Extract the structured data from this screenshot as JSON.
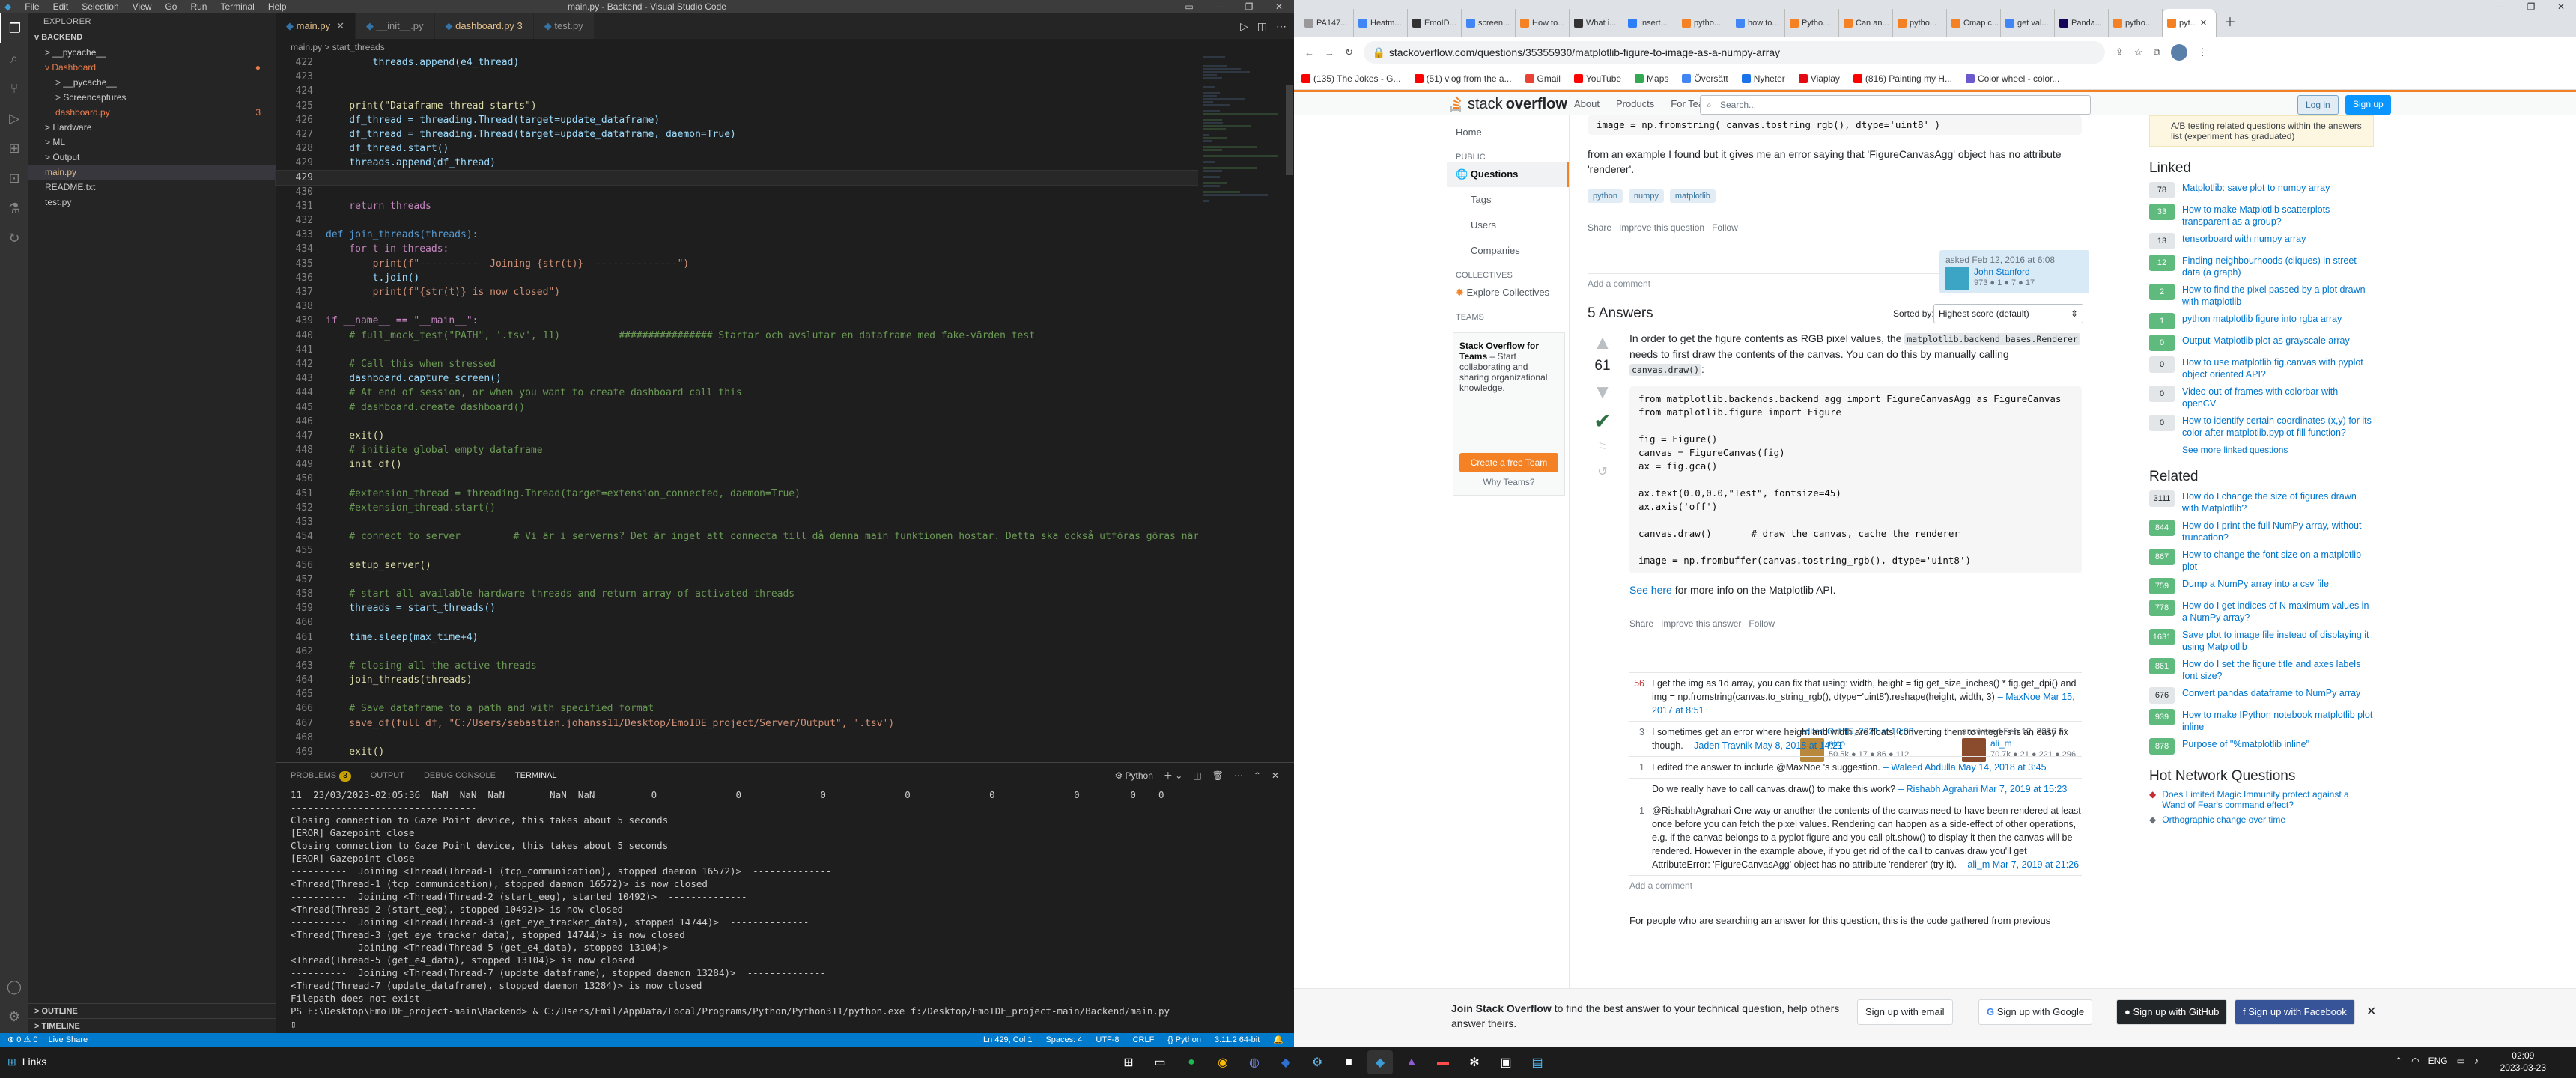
{
  "vscode": {
    "title": "main.py - Backend - Visual Studio Code",
    "menu": [
      "File",
      "Edit",
      "Selection",
      "View",
      "Go",
      "Run",
      "Terminal",
      "Help"
    ],
    "explorer_header": "EXPLORER",
    "root": "BACKEND",
    "tree": [
      {
        "label": "> __pycache__",
        "indent": 1,
        "color": "#cccccc"
      },
      {
        "label": "v Dashboard",
        "indent": 1,
        "color": "#e97c4c",
        "dot": "●"
      },
      {
        "label": "> __pycache__",
        "indent": 2,
        "color": "#cccccc"
      },
      {
        "label": "> Screencaptures",
        "indent": 2,
        "color": "#cccccc"
      },
      {
        "label": "dashboard.py",
        "indent": 2,
        "color": "#e97c4c",
        "dot": "3"
      },
      {
        "label": "> Hardware",
        "indent": 1,
        "color": "#cccccc"
      },
      {
        "label": "> ML",
        "indent": 1,
        "color": "#cccccc"
      },
      {
        "label": "> Output",
        "indent": 1,
        "color": "#cccccc"
      },
      {
        "label": "main.py",
        "indent": 1,
        "color": "#e2c08d"
      },
      {
        "label": "README.txt",
        "indent": 1,
        "color": "#cccccc"
      },
      {
        "label": "test.py",
        "indent": 1,
        "color": "#cccccc"
      }
    ],
    "outline": "> OUTLINE",
    "timeline": "> TIMELINE",
    "tabs": [
      {
        "label": "main.py",
        "active": true,
        "color": "#e2c08d"
      },
      {
        "label": "__init__.py",
        "active": false,
        "color": "#969696"
      },
      {
        "label": "dashboard.py 3",
        "active": false,
        "color": "#e2c08d"
      },
      {
        "label": "test.py",
        "active": false,
        "color": "#969696"
      }
    ],
    "breadcrumb": "main.py > start_threads",
    "code": [
      {
        "n": "422",
        "t": "        threads.append(e4_thread)",
        "k": "vr"
      },
      {
        "n": "423",
        "t": ""
      },
      {
        "n": "424",
        "t": ""
      },
      {
        "n": "425",
        "t": "    print(\"Dataframe thread starts\")",
        "k": "fn"
      },
      {
        "n": "426",
        "t": "    df_thread = threading.Thread(target=update_dataframe)",
        "k": "vr"
      },
      {
        "n": "427",
        "t": "    df_thread = threading.Thread(target=update_dataframe, daemon=True)",
        "k": "vr"
      },
      {
        "n": "428",
        "t": "    df_thread.start()",
        "k": "vr"
      },
      {
        "n": "429",
        "t": "    threads.append(df_thread)",
        "k": "vr"
      },
      {
        "n": "429",
        "t": "",
        "cur": true
      },
      {
        "n": "430",
        "t": ""
      },
      {
        "n": "431",
        "t": "    return threads",
        "k": "kw"
      },
      {
        "n": "432",
        "t": ""
      },
      {
        "n": "433",
        "t": "def join_threads(threads):",
        "k": "bl"
      },
      {
        "n": "434",
        "t": "    for t in threads:",
        "k": "kw"
      },
      {
        "n": "435",
        "t": "        print(f\"----------  Joining {str(t)}  --------------\")",
        "k": "st"
      },
      {
        "n": "436",
        "t": "        t.join()",
        "k": "vr"
      },
      {
        "n": "437",
        "t": "        print(f\"{str(t)} is now closed\")",
        "k": "st"
      },
      {
        "n": "438",
        "t": ""
      },
      {
        "n": "439",
        "t": "if __name__ == \"__main__\":",
        "k": "kw"
      },
      {
        "n": "440",
        "t": "    # full_mock_test(\"PATH\", '.tsv', 11)          ################ Startar och avslutar en dataframe med fake-värden test",
        "k": "cm"
      },
      {
        "n": "441",
        "t": ""
      },
      {
        "n": "442",
        "t": "    # Call this when stressed",
        "k": "cm"
      },
      {
        "n": "443",
        "t": "    dashboard.capture_screen()",
        "k": "vr"
      },
      {
        "n": "444",
        "t": "    # At end of session, or when you want to create dashboard call this",
        "k": "cm"
      },
      {
        "n": "445",
        "t": "    # dashboard.create_dashboard()",
        "k": "cm"
      },
      {
        "n": "446",
        "t": ""
      },
      {
        "n": "447",
        "t": "    exit()",
        "k": "fn"
      },
      {
        "n": "448",
        "t": "    # initiate global empty dataframe",
        "k": "cm"
      },
      {
        "n": "449",
        "t": "    init_df()",
        "k": "fn"
      },
      {
        "n": "450",
        "t": ""
      },
      {
        "n": "451",
        "t": "    #extension_thread = threading.Thread(target=extension_connected, daemon=True)",
        "k": "cm"
      },
      {
        "n": "452",
        "t": "    #extension_thread.start()",
        "k": "cm"
      },
      {
        "n": "453",
        "t": ""
      },
      {
        "n": "454",
        "t": "    # connect to server         # Vi är i serverns? Det är inget att connecta till då denna main funktionen hostar. Detta ska också utföras göras när p",
        "k": "cm"
      },
      {
        "n": "455",
        "t": ""
      },
      {
        "n": "456",
        "t": "    setup_server()",
        "k": "fn"
      },
      {
        "n": "457",
        "t": ""
      },
      {
        "n": "458",
        "t": "    # start all available hardware threads and return array of activated threads",
        "k": "cm"
      },
      {
        "n": "459",
        "t": "    threads = start_threads()",
        "k": "vr"
      },
      {
        "n": "460",
        "t": ""
      },
      {
        "n": "461",
        "t": "    time.sleep(max_time+4)",
        "k": "vr"
      },
      {
        "n": "462",
        "t": ""
      },
      {
        "n": "463",
        "t": "    # closing all the active threads",
        "k": "cm"
      },
      {
        "n": "464",
        "t": "    join_threads(threads)",
        "k": "fn"
      },
      {
        "n": "465",
        "t": ""
      },
      {
        "n": "466",
        "t": "    # Save dataframe to a path and with specified format",
        "k": "cm"
      },
      {
        "n": "467",
        "t": "    save_df(full_df, \"C:/Users/sebastian.johanss11/Desktop/EmoIDE_project/Server/Output\", '.tsv')",
        "k": "st"
      },
      {
        "n": "468",
        "t": ""
      },
      {
        "n": "469",
        "t": "    exit()",
        "k": "fn"
      }
    ],
    "panel_tabs": [
      "PROBLEMS",
      "OUTPUT",
      "DEBUG CONSOLE",
      "TERMINAL"
    ],
    "problems_count": "3",
    "terminal_shell": "Python",
    "terminal": [
      "11  23/03/2023-02:05:36  NaN  NaN  NaN        NaN  NaN          0              0              0              0              0              0         0    0",
      "---------------------------------",
      "Closing connection to Gaze Point device, this takes about 5 seconds",
      "[EROR] Gazepoint close",
      "Closing connection to Gaze Point device, this takes about 5 seconds",
      "[EROR] Gazepoint close",
      "----------  Joining <Thread(Thread-1 (tcp_communication), stopped daemon 16572)>  --------------",
      "<Thread(Thread-1 (tcp_communication), stopped daemon 16572)> is now closed",
      "----------  Joining <Thread(Thread-2 (start_eeg), started 10492)>  --------------",
      "<Thread(Thread-2 (start_eeg), stopped 10492)> is now closed",
      "----------  Joining <Thread(Thread-3 (get_eye_tracker_data), stopped 14744)>  --------------",
      "<Thread(Thread-3 (get_eye_tracker_data), stopped 14744)> is now closed",
      "----------  Joining <Thread(Thread-5 (get_e4_data), stopped 13104)>  --------------",
      "<Thread(Thread-5 (get_e4_data), stopped 13104)> is now closed",
      "----------  Joining <Thread(Thread-7 (update_dataframe), stopped daemon 13284)>  --------------",
      "<Thread(Thread-7 (update_dataframe), stopped daemon 13284)> is now closed",
      "Filepath does not exist",
      "PS F:\\Desktop\\EmoIDE_project-main\\Backend> & C:/Users/Emil/AppData/Local/Programs/Python/Python311/python.exe f:/Desktop/EmoIDE_project-main/Backend/main.py",
      "▯"
    ],
    "status_left": [
      "⊗ 0  ⚠ 0",
      "Live Share"
    ],
    "status_right": [
      "Ln 429, Col 1",
      "Spaces: 4",
      "UTF-8",
      "CRLF",
      "{} Python",
      "3.11.2 64-bit"
    ]
  },
  "browser": {
    "tabs": [
      {
        "label": "PA147...",
        "color": "#999"
      },
      {
        "label": "Heatm...",
        "color": "#4285f4"
      },
      {
        "label": "EmoID...",
        "color": "#333"
      },
      {
        "label": "screen...",
        "color": "#4285f4"
      },
      {
        "label": "How to...",
        "color": "#f48225"
      },
      {
        "label": "What i...",
        "color": "#333"
      },
      {
        "label": "Insert...",
        "color": "#2d7ff9"
      },
      {
        "label": "pytho...",
        "color": "#f48225"
      },
      {
        "label": "how to...",
        "color": "#4285f4"
      },
      {
        "label": "Pytho...",
        "color": "#f48225"
      },
      {
        "label": "Can an...",
        "color": "#f48225"
      },
      {
        "label": "pytho...",
        "color": "#f48225"
      },
      {
        "label": "Cmap c...",
        "color": "#f48225"
      },
      {
        "label": "get val...",
        "color": "#4285f4"
      },
      {
        "label": "Panda...",
        "color": "#150458"
      },
      {
        "label": "pytho...",
        "color": "#f48225"
      },
      {
        "label": "pyt...",
        "color": "#f48225",
        "active": true
      }
    ],
    "url": "stackoverflow.com/questions/35355930/matplotlib-figure-to-image-as-a-numpy-array",
    "bookmarks": [
      "(135) The Jokes - G...",
      "(51) vlog from the a...",
      "Gmail",
      "YouTube",
      "Maps",
      "Översätt",
      "Nyheter",
      "Viaplay",
      "(816) Painting my H...",
      "Color wheel - color..."
    ],
    "bookmark_colors": [
      "#ff0000",
      "#ff0000",
      "#ea4335",
      "#ff0000",
      "#34a853",
      "#4285f4",
      "#1a73e8",
      "#e50914",
      "#ff0000",
      "#6a5acd"
    ]
  },
  "so": {
    "logo_a": "stack",
    "logo_b": "overflow",
    "nav": [
      "About",
      "Products",
      "For Teams"
    ],
    "search_placeholder": "Search...",
    "login": "Log in",
    "signup": "Sign up",
    "left": {
      "home": "Home",
      "public": "PUBLIC",
      "questions": "Questions",
      "tags": "Tags",
      "users": "Users",
      "companies": "Companies",
      "collectives": "COLLECTIVES",
      "explore": "Explore Collectives",
      "teams": "TEAMS",
      "teams_title": "Stack Overflow for Teams",
      "teams_text": "– Start collaborating and sharing organizational knowledge.",
      "teams_btn": "Create a free Team",
      "why": "Why Teams?"
    },
    "q_code_top": "image = np.fromstring( canvas.tostring_rgb(), dtype='uint8' )",
    "q_text": "from an example I found but it gives me an error saying that 'FigureCanvasAgg' object has no attribute 'renderer'.",
    "tags": [
      "python",
      "numpy",
      "matplotlib"
    ],
    "post_menu": [
      "Share",
      "Improve this question",
      "Follow"
    ],
    "asked": "asked Feb 12, 2016 at 6:08",
    "asker": "John Stanford",
    "asker_rep": "973 ● 1 ● 7 ● 17",
    "add_comment": "Add a comment",
    "answers_count": "5 Answers",
    "sorted_by": "Sorted by:",
    "sort_value": "Highest score (default)",
    "vote": "61",
    "a_text1": "In order to get the figure contents as RGB pixel values, the",
    "a_code_inline": "matplotlib.backend_bases.Renderer",
    "a_text2": "needs to first draw the contents of the canvas. You can do this by manually calling",
    "a_code_inline2": "canvas.draw()",
    "a_code": "from matplotlib.backends.backend_agg import FigureCanvasAgg as FigureCanvas\nfrom matplotlib.figure import Figure\n\nfig = Figure()\ncanvas = FigureCanvas(fig)\nax = fig.gca()\n\nax.text(0.0,0.0,\"Test\", fontsize=45)\nax.axis('off')\n\ncanvas.draw()       # draw the canvas, cache the renderer\n\nimage = np.frombuffer(canvas.tostring_rgb(), dtype='uint8')",
    "see_here": "See here",
    "see_rest": "for more info on the Matplotlib API.",
    "a_menu": [
      "Share",
      "Improve this answer",
      "Follow"
    ],
    "edited": "edited Oct 15, 2021 at 10:03",
    "editor": "nico",
    "editor_rep": "50.5k ● 17 ● 86 ● 112",
    "answered": "answered Feb 12, 2016 at 12:34",
    "answerer": "ali_m",
    "answerer_rep": "70.7k ● 21 ● 221 ● 296",
    "comments": [
      {
        "score": "56",
        "hot": true,
        "text": "I get the img as 1d array, you can fix that using: width, height = fig.get_size_inches() * fig.get_dpi() and img = np.fromstring(canvas.to_string_rgb(), dtype='uint8').reshape(height, width, 3)",
        "by": "– MaxNoe Mar 15, 2017 at 8:51"
      },
      {
        "score": "3",
        "text": "I sometimes get an error where height and width are floats, converting them to integers is an easy fix though.",
        "by": "– Jaden Travnik May 8, 2018 at 14:21"
      },
      {
        "score": "1",
        "text": "I edited the answer to include @MaxNoe 's suggestion.",
        "by": "– Waleed Abdulla May 14, 2018 at 3:45"
      },
      {
        "score": "",
        "text": "Do we really have to call canvas.draw() to make this work?",
        "by": "– Rishabh Agrahari Mar 7, 2019 at 15:23"
      },
      {
        "score": "1",
        "text": "@RishabhAgrahari One way or another the contents of the canvas need to have been rendered at least once before you can fetch the pixel values. Rendering can happen as a side-effect of other operations, e.g. if the canvas belongs to a pyplot figure and you call plt.show() to display it then the canvas will be rendered. However in the example above, if you get rid of the call to canvas.draw you'll get AttributeError: 'FigureCanvasAgg' object has no attribute 'renderer' (try it).",
        "by": "– ali_m Mar 7, 2019 at 21:26"
      }
    ],
    "add_comment2": "Add a comment",
    "more_text": "For people who are searching an answer for this question, this is the code gathered from previous",
    "sidebar_note": "A/B testing related questions within the answers list (experiment has graduated)",
    "linked_title": "Linked",
    "linked": [
      {
        "n": "78",
        "acc": false,
        "t": "Matplotlib: save plot to numpy array"
      },
      {
        "n": "33",
        "acc": true,
        "t": "How to make Matplotlib scatterplots transparent as a group?"
      },
      {
        "n": "13",
        "acc": false,
        "t": "tensorboard with numpy array"
      },
      {
        "n": "12",
        "acc": true,
        "t": "Finding neighbourhoods (cliques) in street data (a graph)"
      },
      {
        "n": "2",
        "acc": true,
        "t": "How to find the pixel passed by a plot drawn with matplotlib"
      },
      {
        "n": "1",
        "acc": true,
        "t": "python matplotlib figure into rgba array"
      },
      {
        "n": "0",
        "acc": true,
        "t": "Output Matplotlib plot as grayscale array"
      },
      {
        "n": "0",
        "acc": false,
        "t": "How to use matplotlib fig.canvas with pyplot object oriented API?"
      },
      {
        "n": "0",
        "acc": false,
        "t": "Video out of frames with colorbar with openCV"
      },
      {
        "n": "0",
        "acc": false,
        "t": "How to identify certain coordinates (x,y) for its color after matplotlib.pyplot fill function?"
      }
    ],
    "see_more_linked": "See more linked questions",
    "related_title": "Related",
    "related": [
      {
        "n": "3111",
        "acc": false,
        "t": "How do I change the size of figures drawn with Matplotlib?"
      },
      {
        "n": "844",
        "acc": true,
        "t": "How do I print the full NumPy array, without truncation?"
      },
      {
        "n": "867",
        "acc": true,
        "t": "How to change the font size on a matplotlib plot"
      },
      {
        "n": "759",
        "acc": true,
        "t": "Dump a NumPy array into a csv file"
      },
      {
        "n": "778",
        "acc": true,
        "t": "How do I get indices of N maximum values in a NumPy array?"
      },
      {
        "n": "1631",
        "acc": true,
        "t": "Save plot to image file instead of displaying it using Matplotlib"
      },
      {
        "n": "861",
        "acc": true,
        "t": "How do I set the figure title and axes labels font size?"
      },
      {
        "n": "676",
        "acc": false,
        "t": "Convert pandas dataframe to NumPy array"
      },
      {
        "n": "939",
        "acc": true,
        "t": "How to make IPython notebook matplotlib plot inline"
      },
      {
        "n": "878",
        "acc": true,
        "t": "Purpose of \"%matplotlib inline\""
      }
    ],
    "hot_title": "Hot Network Questions",
    "hot": [
      "Does Limited Magic Immunity protect against a Wand of Fear's command effect?",
      "Orthographic change over time"
    ],
    "join_title": "Join Stack Overflow",
    "join_text": "to find the best answer to your technical question, help others answer theirs.",
    "join_btns": [
      "Sign up with email",
      "Sign up with Google",
      "Sign up with GitHub",
      "Sign up with Facebook"
    ]
  },
  "taskbar": {
    "left": "Links",
    "lang": "ENG",
    "time": "02:09",
    "date": "2023-03-23"
  }
}
